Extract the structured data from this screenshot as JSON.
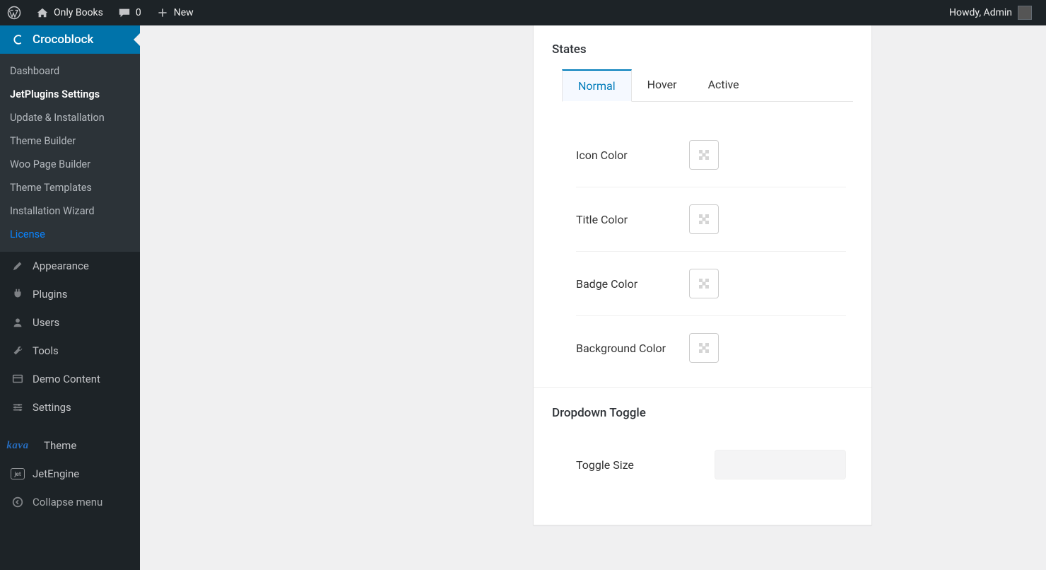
{
  "adminbar": {
    "site_title": "Only Books",
    "comments_count": "0",
    "new_label": "New",
    "howdy": "Howdy, Admin"
  },
  "sidebar": {
    "open_item": "Crocoblock",
    "submenu": [
      {
        "label": "Dashboard"
      },
      {
        "label": "JetPlugins Settings",
        "current": true
      },
      {
        "label": "Update & Installation"
      },
      {
        "label": "Theme Builder"
      },
      {
        "label": "Woo Page Builder"
      },
      {
        "label": "Theme Templates"
      },
      {
        "label": "Installation Wizard"
      },
      {
        "label": "License",
        "highlight": true
      }
    ],
    "items": [
      {
        "label": "Appearance",
        "icon": "appearance"
      },
      {
        "label": "Plugins",
        "icon": "plugins"
      },
      {
        "label": "Users",
        "icon": "users"
      },
      {
        "label": "Tools",
        "icon": "tools"
      },
      {
        "label": "Demo Content",
        "icon": "demo"
      },
      {
        "label": "Settings",
        "icon": "settings"
      }
    ],
    "extra": [
      {
        "label": "Theme",
        "icon": "kava"
      },
      {
        "label": "JetEngine",
        "icon": "jet"
      }
    ],
    "collapse": "Collapse menu"
  },
  "panel": {
    "states": {
      "title": "States",
      "tabs": [
        "Normal",
        "Hover",
        "Active"
      ],
      "active_tab": 0,
      "fields": [
        {
          "label": "Icon Color"
        },
        {
          "label": "Title Color"
        },
        {
          "label": "Badge Color"
        },
        {
          "label": "Background Color"
        }
      ]
    },
    "dropdown": {
      "title": "Dropdown Toggle",
      "fields": [
        {
          "label": "Toggle Size"
        }
      ]
    }
  }
}
